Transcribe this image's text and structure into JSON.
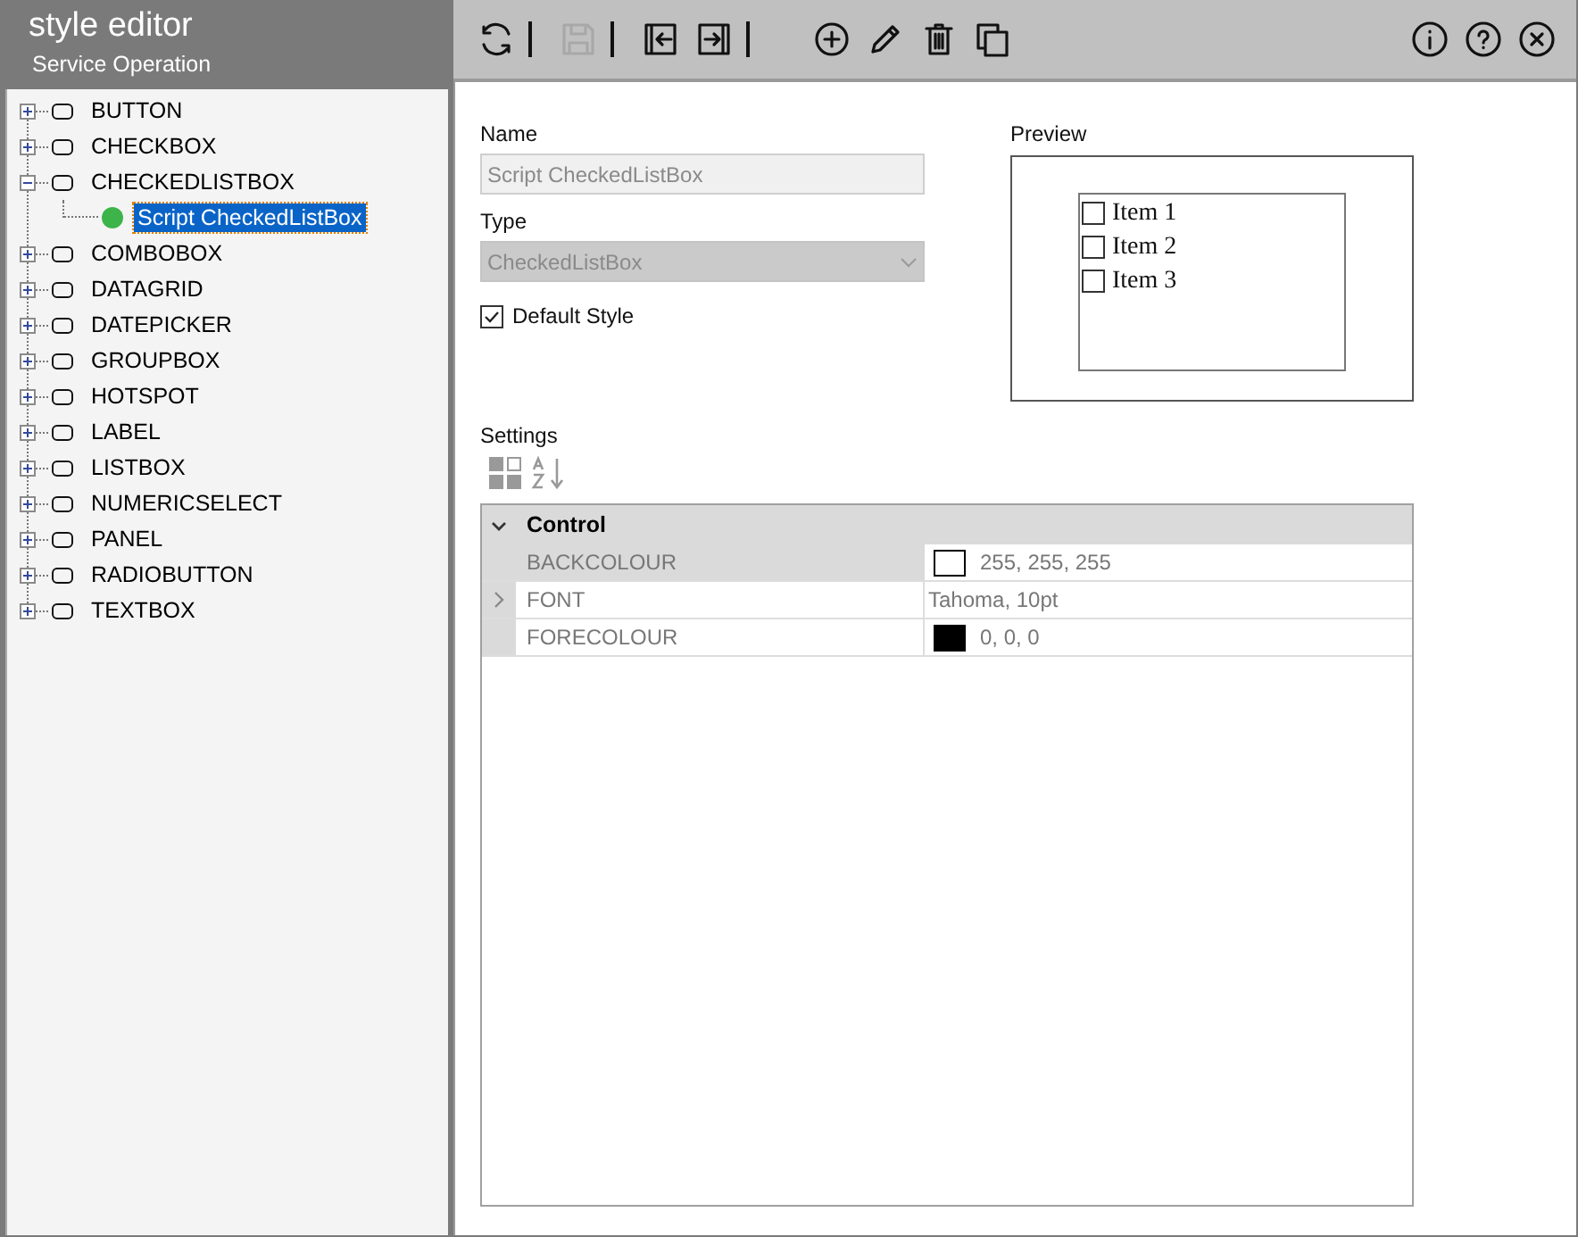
{
  "app": {
    "title": "style editor",
    "subtitle": "Service Operation"
  },
  "toolbar": {
    "left": [
      {
        "kind": "refresh",
        "disabled": false
      },
      {
        "kind": "separator"
      },
      {
        "kind": "save",
        "disabled": true
      },
      {
        "kind": "separator"
      },
      {
        "kind": "import",
        "disabled": false
      },
      {
        "kind": "export",
        "disabled": false
      },
      {
        "kind": "separator"
      },
      {
        "kind": "add",
        "disabled": false
      },
      {
        "kind": "edit",
        "disabled": false
      },
      {
        "kind": "delete",
        "disabled": false
      },
      {
        "kind": "copy",
        "disabled": false
      }
    ],
    "right": [
      {
        "kind": "info",
        "disabled": false
      },
      {
        "kind": "help",
        "disabled": false
      },
      {
        "kind": "close",
        "disabled": false
      }
    ]
  },
  "tree": [
    {
      "label": "BUTTON",
      "expanded": false,
      "selected": false
    },
    {
      "label": "CHECKBOX",
      "expanded": false,
      "selected": false
    },
    {
      "label": "CHECKEDLISTBOX",
      "expanded": true,
      "selected": false,
      "children": [
        {
          "label": "Script CheckedListBox",
          "selected": true,
          "color": "#3cb44a"
        }
      ]
    },
    {
      "label": "COMBOBOX",
      "expanded": false,
      "selected": false
    },
    {
      "label": "DATAGRID",
      "expanded": false,
      "selected": false
    },
    {
      "label": "DATEPICKER",
      "expanded": false,
      "selected": false
    },
    {
      "label": "GROUPBOX",
      "expanded": false,
      "selected": false
    },
    {
      "label": "HOTSPOT",
      "expanded": false,
      "selected": false
    },
    {
      "label": "LABEL",
      "expanded": false,
      "selected": false
    },
    {
      "label": "LISTBOX",
      "expanded": false,
      "selected": false
    },
    {
      "label": "NUMERICSELECT",
      "expanded": false,
      "selected": false
    },
    {
      "label": "PANEL",
      "expanded": false,
      "selected": false
    },
    {
      "label": "RADIOBUTTON",
      "expanded": false,
      "selected": false
    },
    {
      "label": "TEXTBOX",
      "expanded": false,
      "selected": false
    }
  ],
  "form": {
    "name_label": "Name",
    "name_value": "Script CheckedListBox",
    "type_label": "Type",
    "type_value": "CheckedListBox",
    "default_style": {
      "label": "Default Style",
      "checked": true
    },
    "settings_label": "Settings"
  },
  "preview": {
    "label": "Preview",
    "items": [
      {
        "label": "Item 1",
        "checked": false
      },
      {
        "label": "Item 2",
        "checked": false
      },
      {
        "label": "Item 3",
        "checked": false
      }
    ]
  },
  "properties": {
    "category": "Control",
    "expanded": true,
    "rows": [
      {
        "name": "BACKCOLOUR",
        "kind": "color",
        "color": "#ffffff",
        "value": "255, 255, 255",
        "selected": true,
        "expandable": false
      },
      {
        "name": "FONT",
        "kind": "text",
        "value": "Tahoma, 10pt",
        "selected": false,
        "expandable": true
      },
      {
        "name": "FORECOLOUR",
        "kind": "color",
        "color": "#000000",
        "value": "0, 0, 0",
        "selected": false,
        "expandable": false
      }
    ]
  }
}
